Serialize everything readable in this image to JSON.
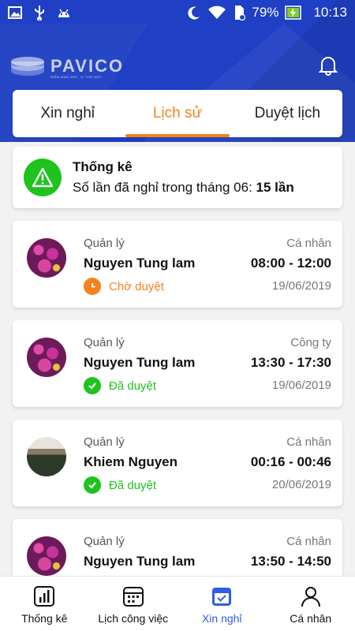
{
  "status_bar": {
    "battery": "79%",
    "time": "10:13"
  },
  "header": {
    "logo_text": "PAVICO",
    "logo_tagline": "DIỆN MẠO MỚI, VỊ THẾ MỚI"
  },
  "tabs": [
    {
      "label": "Xin nghỉ",
      "active": false
    },
    {
      "label": "Lịch sử",
      "active": true
    },
    {
      "label": "Duyệt lịch",
      "active": false
    }
  ],
  "stats": {
    "title": "Thống kê",
    "line_prefix": "Số lần đã nghỉ trong tháng 06:",
    "line_value": "15 lần"
  },
  "requests": [
    {
      "role": "Quản lý",
      "name": "Nguyen Tung lam",
      "type": "Cá nhân",
      "time": "08:00 - 12:00",
      "date": "19/06/2019",
      "status": "Chờ duyệt",
      "status_kind": "pending",
      "avatar": "flowers"
    },
    {
      "role": "Quản lý",
      "name": "Nguyen Tung lam",
      "type": "Công ty",
      "time": "13:30 - 17:30",
      "date": "19/06/2019",
      "status": "Đã duyệt",
      "status_kind": "approved",
      "avatar": "flowers"
    },
    {
      "role": "Quản lý",
      "name": "Khiem Nguyen",
      "type": "Cá nhân",
      "time": "00:16 - 00:46",
      "date": "20/06/2019",
      "status": "Đã duyệt",
      "status_kind": "approved",
      "avatar": "landscape"
    },
    {
      "role": "Quản lý",
      "name": "Nguyen Tung lam",
      "type": "Cá nhân",
      "time": "13:50 - 14:50",
      "date": "",
      "status": "",
      "status_kind": "approved",
      "avatar": "flowers"
    }
  ],
  "bottom_nav": [
    {
      "label": "Thống kê",
      "icon": "chart-icon",
      "active": false
    },
    {
      "label": "Lịch công việc",
      "icon": "calendar-icon",
      "active": false
    },
    {
      "label": "Xin nghỉ",
      "icon": "calendar-check-icon",
      "active": true
    },
    {
      "label": "Cá nhân",
      "icon": "user-icon",
      "active": false
    }
  ],
  "colors": {
    "primary": "#1f3fc4",
    "accent": "#f5821f",
    "approved": "#1ec31e",
    "pending": "#f5821f",
    "nav_active": "#2f5ee0"
  }
}
